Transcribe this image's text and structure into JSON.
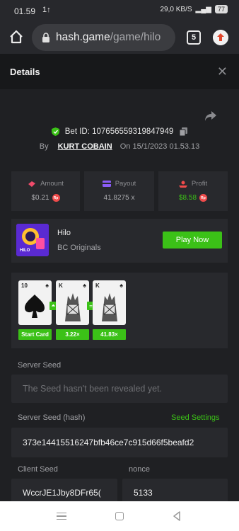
{
  "status_bar": {
    "time": "01.59",
    "signal_small": "1↑",
    "network_speed": "29,0 KB/S",
    "battery": "77"
  },
  "browser": {
    "url_host": "hash.game",
    "url_path": "/game/hilo",
    "tab_count": "5"
  },
  "header": {
    "title": "Details",
    "close": "✕"
  },
  "bet": {
    "id_label": "Bet ID:",
    "id": "107656559319847949",
    "by_label": "By",
    "user": "KURT COBAIN",
    "on_label": "On",
    "date": "15/1/2023 01.53.13"
  },
  "stats": {
    "amount_label": "Amount",
    "amount_value": "$0.21",
    "payout_label": "Payout",
    "payout_value": "41.8275 x",
    "profit_label": "Profit",
    "profit_value": "$8.58",
    "currency_badge": "Rp",
    "profit_color": "#3bc117"
  },
  "game": {
    "name": "Hilo",
    "provider": "BC Originals",
    "play_label": "Play Now",
    "thumb_text": "HILO"
  },
  "cards": {
    "items": [
      {
        "rank": "10",
        "suit": "♠"
      },
      {
        "rank": "K",
        "suit": "♠"
      },
      {
        "rank": "K",
        "suit": "♠"
      }
    ],
    "arrows": [
      "⏶",
      "="
    ],
    "tags": [
      "Start Card",
      "3.22×",
      "41.83×"
    ]
  },
  "seeds": {
    "server_seed_label": "Server Seed",
    "server_seed_value": "The Seed hasn't been revealed yet.",
    "server_hash_label": "Server Seed (hash)",
    "seed_settings_label": "Seed Settings",
    "server_hash_value": "373e14415516247bfb46ce7c915d66f5beafd2",
    "client_seed_label": "Client Seed",
    "client_seed_value": "WccrJE1Jby8DFr65(",
    "nonce_label": "nonce",
    "nonce_value": "5133"
  },
  "colors": {
    "accent": "#3bc117",
    "background": "#1f2023",
    "panel": "#28292d"
  }
}
